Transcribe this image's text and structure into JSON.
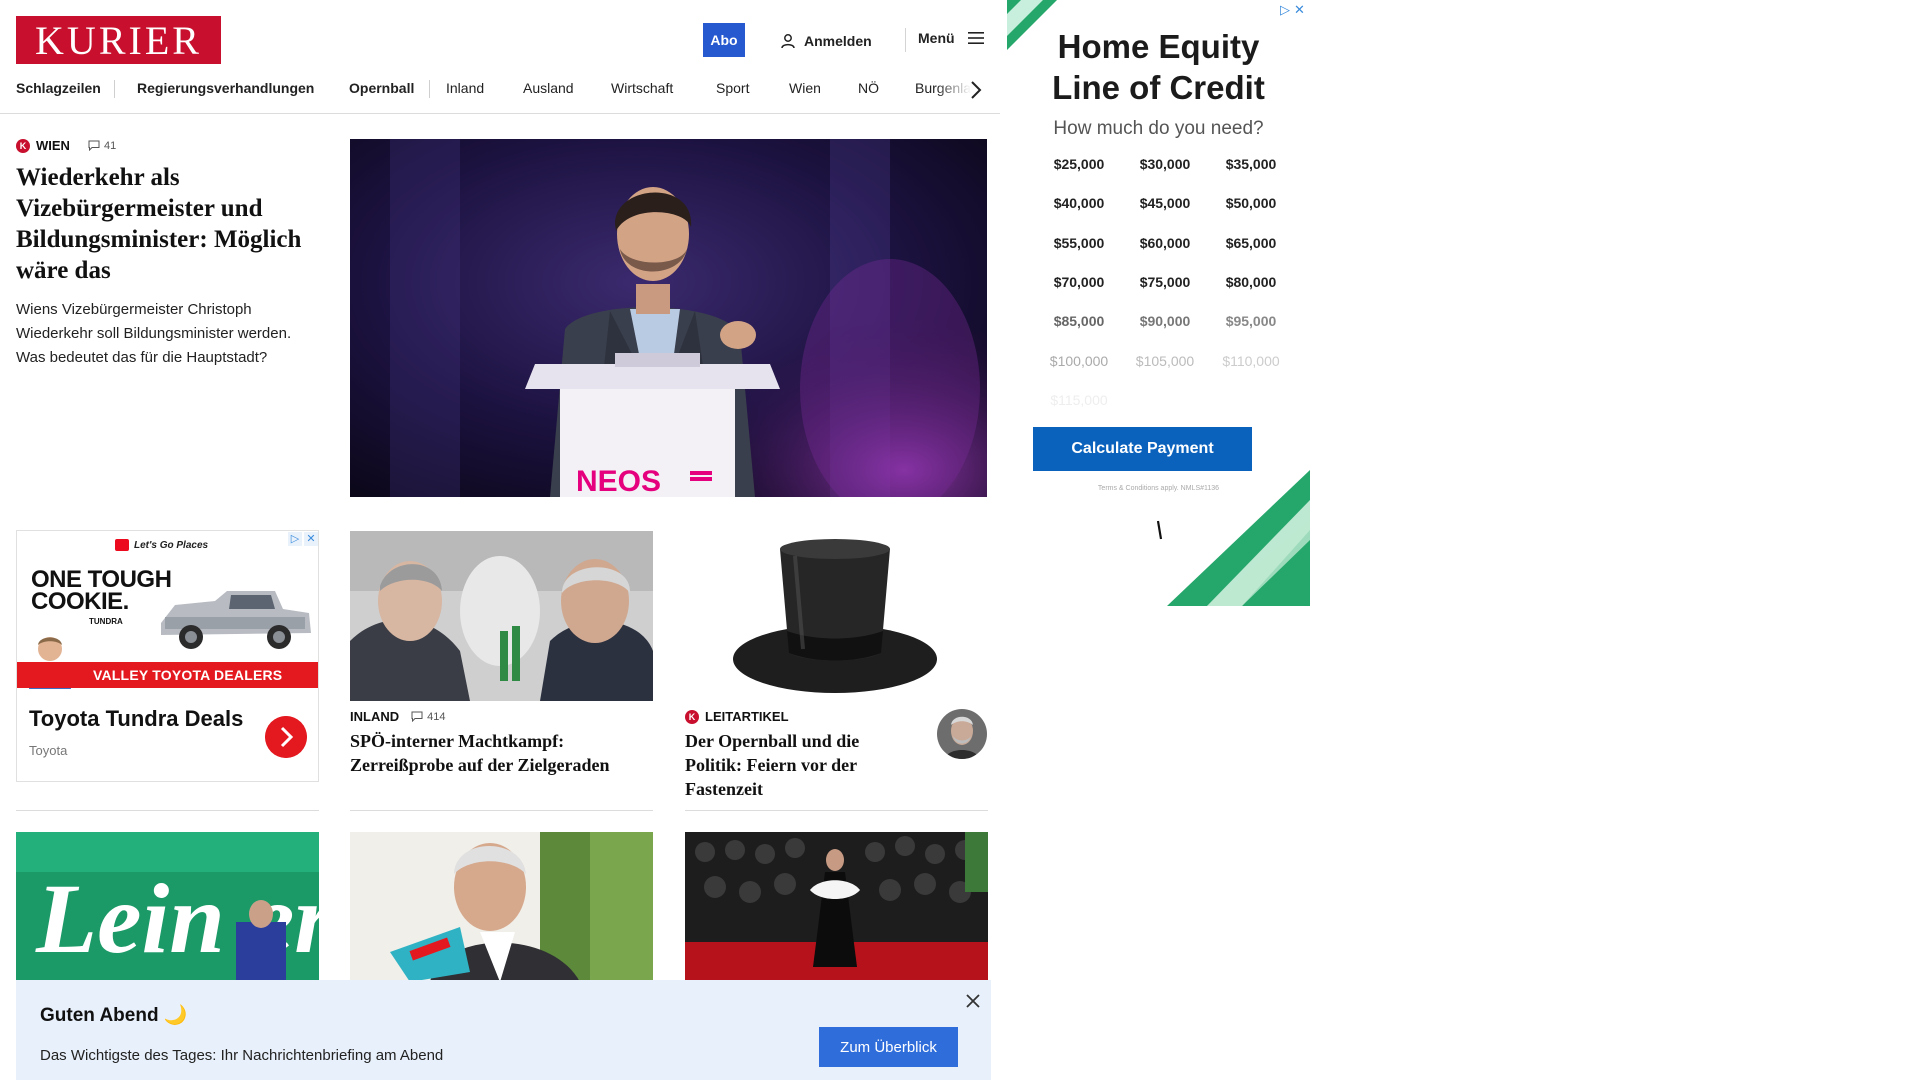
{
  "header": {
    "logo_text": "KURIER",
    "abo_label": "Abo",
    "login_label": "Anmelden",
    "menu_label": "Menü"
  },
  "nav": {
    "items": [
      {
        "label": "Schlagzeilen",
        "bold": true
      },
      {
        "label": "Regierungsverhandlungen",
        "bold": true
      },
      {
        "label": "Opernball",
        "bold": true
      },
      {
        "label": "Inland",
        "bold": false
      },
      {
        "label": "Ausland",
        "bold": false
      },
      {
        "label": "Wirtschaft",
        "bold": false
      },
      {
        "label": "Sport",
        "bold": false
      },
      {
        "label": "Wien",
        "bold": false
      },
      {
        "label": "NÖ",
        "bold": false
      },
      {
        "label": "Burgenland",
        "bold": false
      }
    ]
  },
  "lead": {
    "kicker": "WIEN",
    "comments": "41",
    "headline": "Wiederkehr als Vizebürgermeister und Bildungsminister: Möglich wäre das",
    "teaser": "Wiens Vizebürgermeister Christoph Wiederkehr soll Bildungsminister werden. Was bedeutet das für die Hauptstadt?",
    "image_podium_text": "NEOS"
  },
  "toyota_ad": {
    "brand_line": "Let's Go Places",
    "headline_1": "ONE TOUGH",
    "headline_2": "COOKIE.",
    "model": "TUNDRA",
    "strip": "VALLEY TOYOTA DEALERS",
    "title": "Toyota Tundra Deals",
    "advertiser": "Toyota",
    "ad_icons": [
      "▷",
      "✕"
    ]
  },
  "stories": [
    {
      "kicker": "INLAND",
      "comments": "414",
      "headline": "SPÖ-interner Machtkampf: Zerreißprobe auf der Zielgeraden"
    },
    {
      "kicker": "LEITARTIKEL",
      "headline": "Der Opernball und die Politik: Feiern vor der Fastenzeit"
    }
  ],
  "bottom_images": {
    "leiner_text": "Lein er"
  },
  "notification": {
    "title": "Guten Abend 🌙",
    "text": "Das Wichtigste des Tages: Ihr Nachrichtenbriefing am Abend",
    "button": "Zum Überblick"
  },
  "home_equity_ad": {
    "title_line1": "Home Equity",
    "title_line2": "Line of Credit",
    "subtitle": "How much do you need?",
    "amounts": [
      "$25,000",
      "$30,000",
      "$35,000",
      "$40,000",
      "$45,000",
      "$50,000",
      "$55,000",
      "$60,000",
      "$65,000",
      "$70,000",
      "$75,000",
      "$80,000",
      "$85,000",
      "$90,000",
      "$95,000",
      "$100,000",
      "$105,000",
      "$110,000",
      "$115,000"
    ],
    "button": "Calculate Payment",
    "terms": "Terms & Conditions apply. NMLS#1136",
    "ad_icons": [
      "▷",
      "✕"
    ]
  },
  "colors": {
    "brand_red": "#c8102e",
    "abo_blue": "#2659d0",
    "notify_bg": "#e8f0fb",
    "cta_blue": "#0b62bd",
    "accent_green": "#25a66a"
  }
}
